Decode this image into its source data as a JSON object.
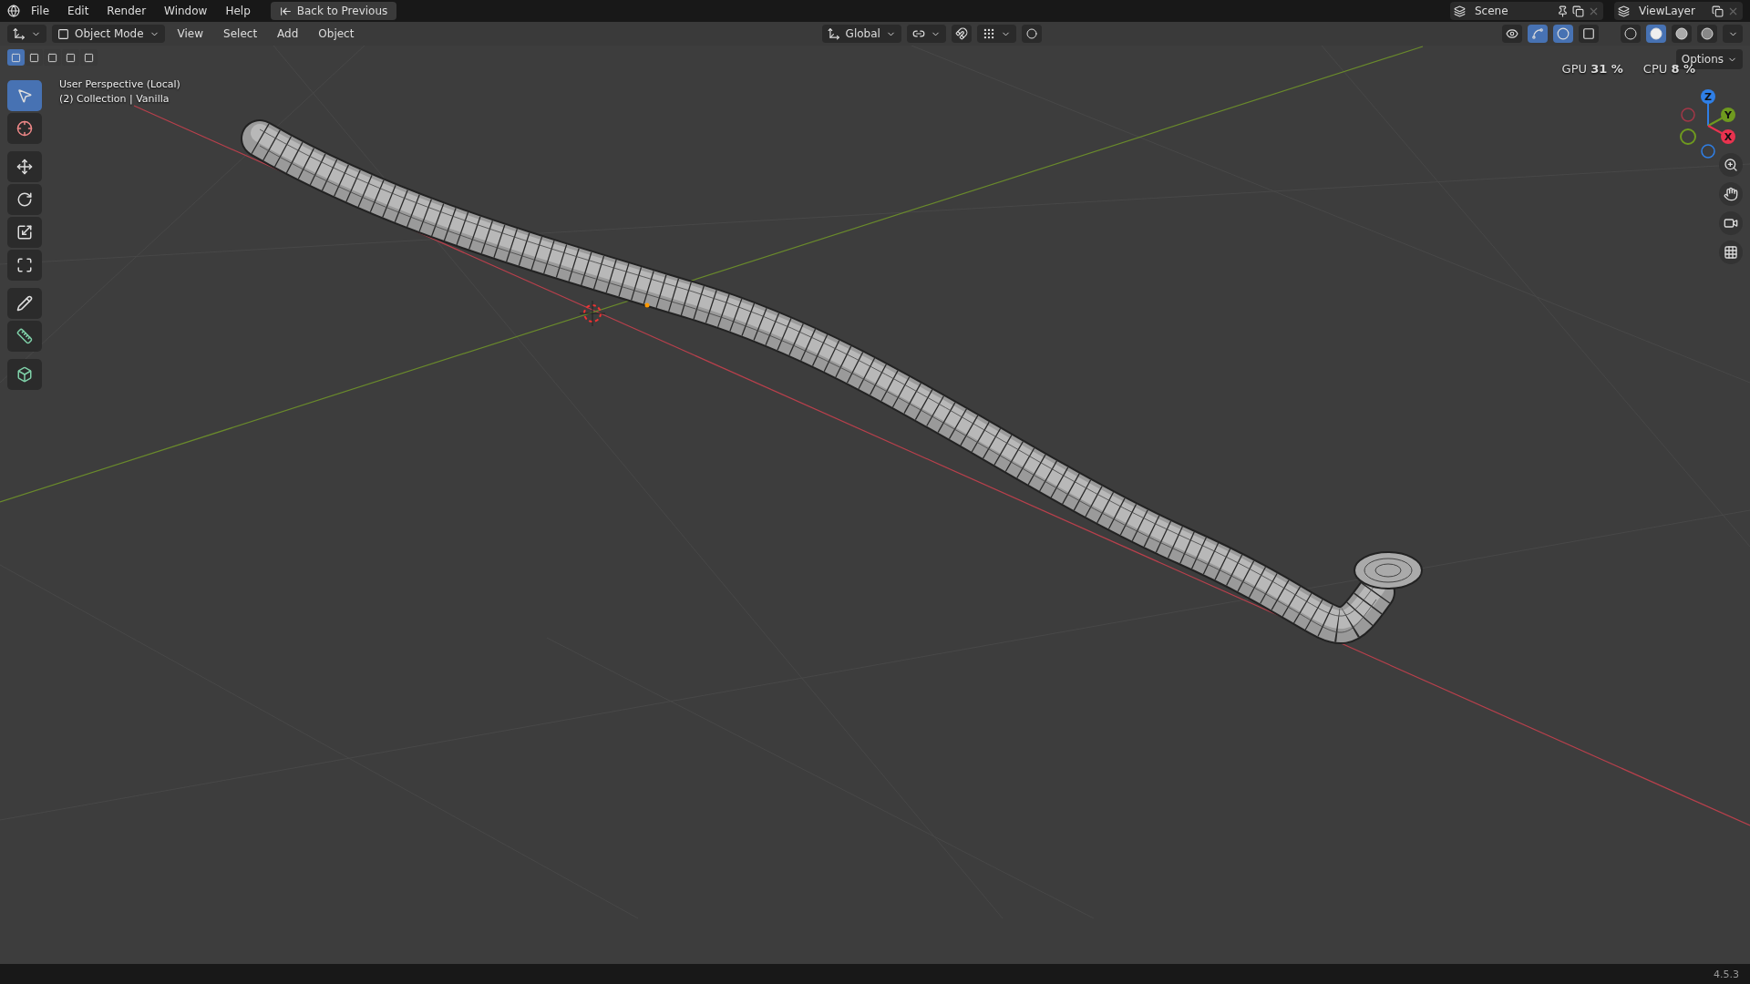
{
  "top_bar": {
    "menus": [
      "File",
      "Edit",
      "Render",
      "Window",
      "Help"
    ],
    "back_button": "Back to Previous",
    "scene": "Scene",
    "view_layer": "ViewLayer"
  },
  "stats": [
    {
      "label": "GPU",
      "value": "31 %"
    },
    {
      "label": "CPU",
      "value": "8 %"
    }
  ],
  "header": {
    "mode": "Object Mode",
    "menus": [
      "View",
      "Select",
      "Add",
      "Object"
    ],
    "orientation": "Global"
  },
  "viewport_toggles": [
    {
      "kind": "visibility",
      "on": false
    },
    {
      "kind": "gizmos",
      "on": true
    },
    {
      "kind": "overlays",
      "on": true
    },
    {
      "kind": "xray",
      "on": false
    }
  ],
  "shading": [
    {
      "kind": "wireframe",
      "selected": false
    },
    {
      "kind": "solid",
      "selected": true
    },
    {
      "kind": "material",
      "selected": false
    },
    {
      "kind": "rendered",
      "selected": false
    }
  ],
  "options_button": "Options",
  "select_modes": [
    {
      "selected": true
    },
    {
      "selected": false
    },
    {
      "selected": false
    },
    {
      "selected": false
    },
    {
      "selected": false
    }
  ],
  "tool_groups": [
    {
      "tools": [
        {
          "kind": "select",
          "selected": true
        },
        {
          "kind": "cursor",
          "selected": false
        }
      ]
    },
    {
      "tools": [
        {
          "kind": "move",
          "selected": false
        },
        {
          "kind": "rotate",
          "selected": false
        },
        {
          "kind": "scale",
          "selected": false
        },
        {
          "kind": "transform",
          "selected": false
        }
      ]
    },
    {
      "tools": [
        {
          "kind": "annotate",
          "selected": false
        },
        {
          "kind": "measure",
          "selected": false
        }
      ]
    },
    {
      "tools": [
        {
          "kind": "add_cube",
          "selected": false
        }
      ]
    }
  ],
  "viewport": {
    "info": [
      "User Perspective (Local)",
      "(2) Collection | Vanilla"
    ],
    "gizmo_axes": [
      {
        "label": "Z",
        "color": "#2f7fe6"
      },
      {
        "label": "Y",
        "color": "#6f9a1f"
      },
      {
        "label": "X",
        "color": "#e8334f"
      }
    ]
  },
  "status_bar": {
    "version": "4.5.3"
  }
}
